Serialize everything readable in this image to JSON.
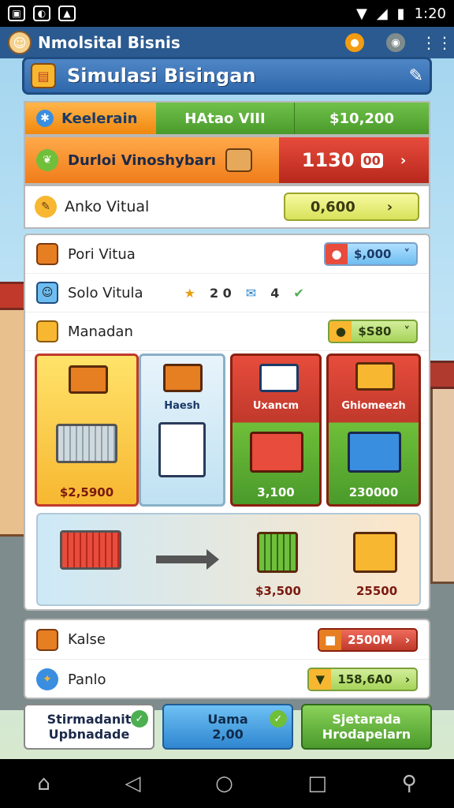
{
  "status": {
    "time": "1:20"
  },
  "app": {
    "title": "Nmolsital Bisnis"
  },
  "header": {
    "title": "Simulasi Bisingan"
  },
  "top_row": {
    "label": "Keelerain",
    "mid": "HAtao VIII",
    "value": "$10,200"
  },
  "promo_row": {
    "label": "Durloi Vinoshybarı",
    "value": "1130",
    "badge": "00"
  },
  "virtual_row": {
    "label": "Anko Vitual",
    "value": "0,600"
  },
  "list": [
    {
      "label": "Pori Vitua",
      "value": "$,000"
    },
    {
      "label": "Solo Vitula",
      "stats": [
        "2 0",
        "4"
      ]
    },
    {
      "label": "Manadan",
      "value": "$S80"
    }
  ],
  "tiles": [
    {
      "label": "",
      "price": "$2,5900"
    },
    {
      "label": "Haesh",
      "price": ""
    },
    {
      "label": "Uxancm",
      "price": "3,100"
    },
    {
      "label": "Ghiomeezh",
      "price": "230000"
    }
  ],
  "flow": {
    "price_left": "$3,500",
    "price_right": "25500"
  },
  "bottom_list": [
    {
      "label": "Kalse",
      "value": "2500M"
    },
    {
      "label": "Panlo",
      "value": "158,6A0"
    }
  ],
  "actions": [
    {
      "line1": "Stirmadanit",
      "line2": "Upbnadade"
    },
    {
      "line1": "Uama",
      "line2": "2,00"
    },
    {
      "line1": "Sjetarada",
      "line2": "Hrodapelarn"
    }
  ],
  "colors": {
    "appbar": "#2a5a8f",
    "accent_orange": "#f0880e",
    "accent_green": "#4a9a2b",
    "accent_red": "#c0392b"
  }
}
